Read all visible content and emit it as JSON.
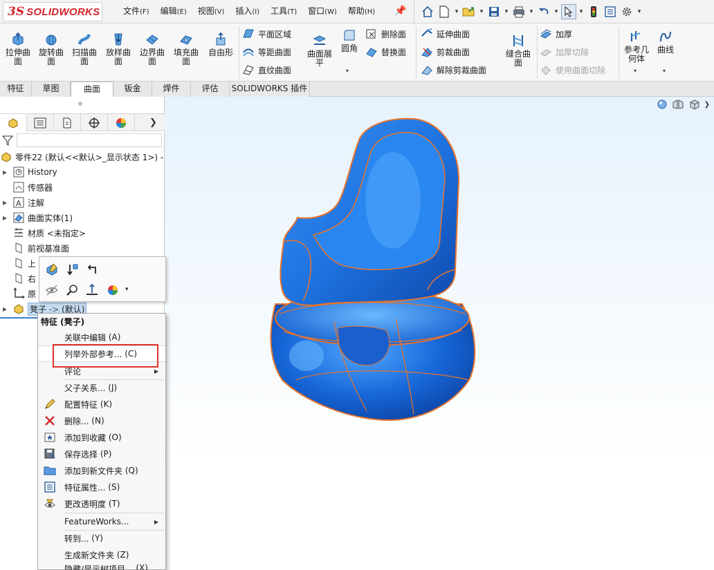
{
  "app": {
    "logo_ds": "3S",
    "logo_name": "SOLIDWORKS"
  },
  "menu": [
    {
      "label": "文件",
      "key": "(F)"
    },
    {
      "label": "编辑",
      "key": "(E)"
    },
    {
      "label": "视图",
      "key": "(V)"
    },
    {
      "label": "插入",
      "key": "(I)"
    },
    {
      "label": "工具",
      "key": "(T)"
    },
    {
      "label": "窗口",
      "key": "(W)"
    },
    {
      "label": "帮助",
      "key": "(H)"
    }
  ],
  "ribbon": {
    "extrude": [
      "拉伸曲",
      "面"
    ],
    "revolve": [
      "旋转曲",
      "面"
    ],
    "sweep": [
      "扫描曲",
      "面"
    ],
    "loft": [
      "放样曲",
      "面"
    ],
    "boundary": [
      "边界曲",
      "面"
    ],
    "fill": [
      "填充曲",
      "面"
    ],
    "freeform": [
      "自由形"
    ],
    "planar": "平面区域",
    "offset": "等距曲面",
    "ruled": "直纹曲面",
    "flatten": [
      "曲面展",
      "平"
    ],
    "fillet": "圆角",
    "delete_face": "删除面",
    "replace_face": "替换面",
    "extend": "延伸曲面",
    "trim": "剪裁曲面",
    "untrim": "解除剪裁曲面",
    "knit": [
      "缝合曲",
      "面"
    ],
    "thicken": "加厚",
    "thicken_cut": "加厚切除",
    "surface_cut": "使用曲面切除",
    "ref_geom": [
      "参考几",
      "何体"
    ],
    "curves": "曲线"
  },
  "tabs": [
    "特征",
    "草图",
    "曲面",
    "钣金",
    "焊件",
    "评估",
    "SOLIDWORKS 插件"
  ],
  "active_tab": "曲面",
  "tree": {
    "root": "零件22 (默认<<默认>_显示状态 1>) -",
    "history": "History",
    "sensors": "传感器",
    "annotations": "注解",
    "surface_bodies": "曲面实体(1)",
    "material": "材质 <未指定>",
    "front_plane": "前视基准面",
    "top_plane_partial": "上",
    "right_plane_partial": "右",
    "origin_partial": "原",
    "feature": "凳子",
    "feature_suffix": "(默认)"
  },
  "context_menu": {
    "header": "特征 (凳子)",
    "items": [
      {
        "label": "关联中编辑",
        "key": "(A)"
      },
      {
        "label": "列举外部参考...",
        "key": "(C)"
      },
      {
        "label": "评论",
        "key": ""
      },
      {
        "label": "父子关系...",
        "key": "(J)"
      },
      {
        "label": "配置特征",
        "key": "(K)"
      },
      {
        "label": "删除...",
        "key": "(N)"
      },
      {
        "label": "添加到收藏",
        "key": "(O)"
      },
      {
        "label": "保存选择",
        "key": "(P)"
      },
      {
        "label": "添加到新文件夹",
        "key": "(Q)"
      },
      {
        "label": "特征属性...",
        "key": "(S)"
      },
      {
        "label": "更改透明度",
        "key": "(T)"
      },
      {
        "label": "FeatureWorks...",
        "key": ""
      },
      {
        "label": "转到...",
        "key": "(Y)"
      },
      {
        "label": "生成新文件夹",
        "key": "(Z)"
      },
      {
        "label": "隐藏/显示树项目...",
        "key": "(X)"
      }
    ]
  },
  "colors": {
    "model_blue": "#1a6fd6",
    "edge_orange": "#e8742c",
    "highlight_red": "#e0312c",
    "brand_red": "#d12229"
  }
}
